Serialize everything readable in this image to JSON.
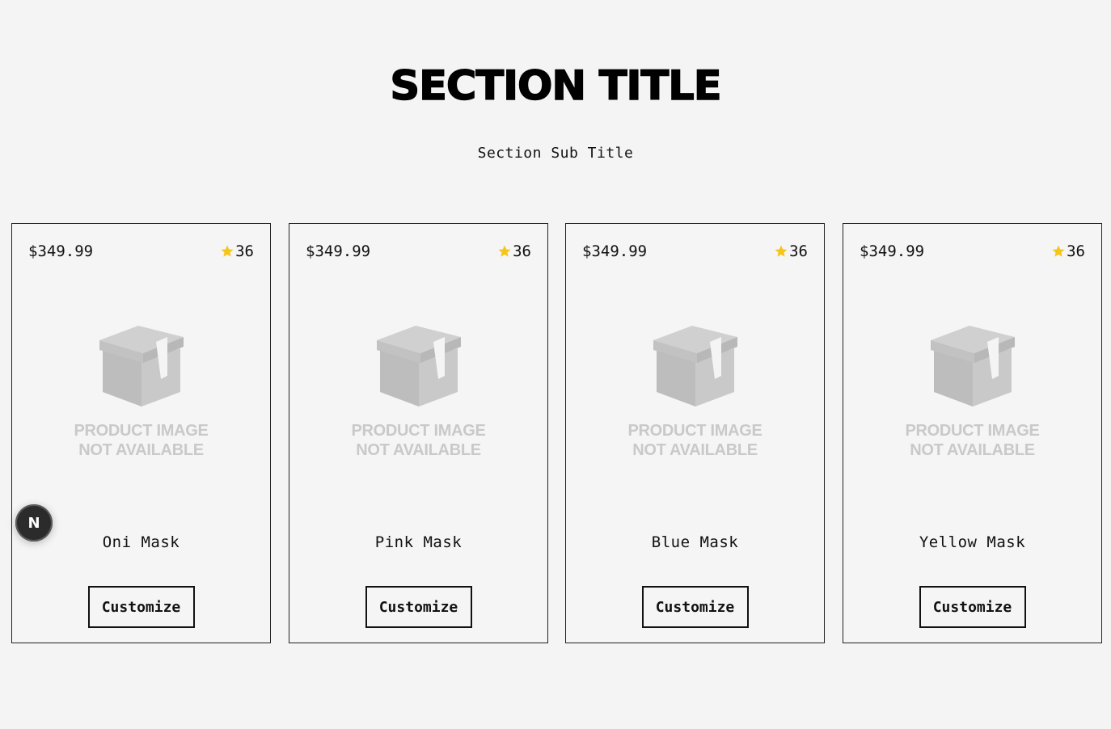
{
  "header": {
    "title": "SECTION TITLE",
    "subtitle": "Section Sub Title"
  },
  "products": [
    {
      "price": "$349.99",
      "rating": "36",
      "placeholder_line1": "PRODUCT IMAGE",
      "placeholder_line2": "NOT AVAILABLE",
      "name": "Oni Mask",
      "button_label": "Customize"
    },
    {
      "price": "$349.99",
      "rating": "36",
      "placeholder_line1": "PRODUCT IMAGE",
      "placeholder_line2": "NOT AVAILABLE",
      "name": "Pink Mask",
      "button_label": "Customize"
    },
    {
      "price": "$349.99",
      "rating": "36",
      "placeholder_line1": "PRODUCT IMAGE",
      "placeholder_line2": "NOT AVAILABLE",
      "name": "Blue Mask",
      "button_label": "Customize"
    },
    {
      "price": "$349.99",
      "rating": "36",
      "placeholder_line1": "PRODUCT IMAGE",
      "placeholder_line2": "NOT AVAILABLE",
      "name": "Yellow Mask",
      "button_label": "Customize"
    }
  ],
  "dev_badge": {
    "label": "N"
  },
  "icons": {
    "rating": "star-icon",
    "placeholder": "box-icon"
  },
  "colors": {
    "background": "#f4f4f4",
    "star": "#f5c518",
    "placeholder": "#c4c4c4"
  }
}
